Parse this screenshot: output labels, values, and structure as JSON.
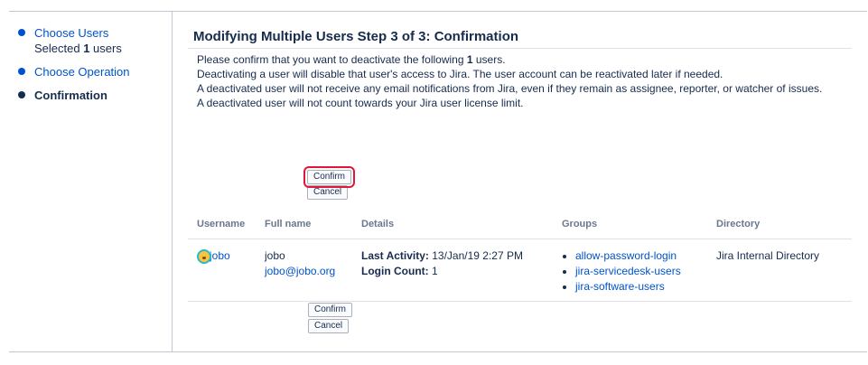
{
  "sidebar": {
    "steps": [
      {
        "label": "Choose Users",
        "sub_prefix": "Selected ",
        "sub_count": "1",
        "sub_suffix": " users"
      },
      {
        "label": "Choose Operation"
      },
      {
        "label": "Confirmation"
      }
    ]
  },
  "main": {
    "title": "Modifying Multiple Users Step 3 of 3: Confirmation",
    "desc_1_prefix": "Please confirm that you want to deactivate the following ",
    "desc_1_count": "1",
    "desc_1_suffix": " users.",
    "desc_2": "Deactivating a user will disable that user's access to Jira. The user account can be reactivated later if needed.",
    "desc_3": "A deactivated user will not receive any email notifications from Jira, even if they remain as assignee, reporter, or watcher of issues.",
    "desc_4": "A deactivated user will not count towards your Jira user license limit.",
    "confirm_label": "Confirm",
    "cancel_label": "Cancel"
  },
  "table": {
    "headers": [
      "Username",
      "Full name",
      "Details",
      "Groups",
      "Directory"
    ],
    "rows": [
      {
        "username": "jobo",
        "full_name": "jobo",
        "email": "jobo@jobo.org",
        "last_activity_label": "Last Activity:",
        "last_activity_value": " 13/Jan/19 2:27 PM",
        "login_count_label": "Login Count:",
        "login_count_value": " 1",
        "groups": [
          "allow-password-login",
          "jira-servicedesk-users",
          "jira-software-users"
        ],
        "directory": "Jira Internal Directory"
      }
    ]
  },
  "colors": {
    "link": "#0052cc",
    "text": "#172b4d",
    "highlight": "#e0173a"
  },
  "icons": {
    "step_bullet": "bullet-dot-icon",
    "avatar": "user-avatar-icon"
  }
}
